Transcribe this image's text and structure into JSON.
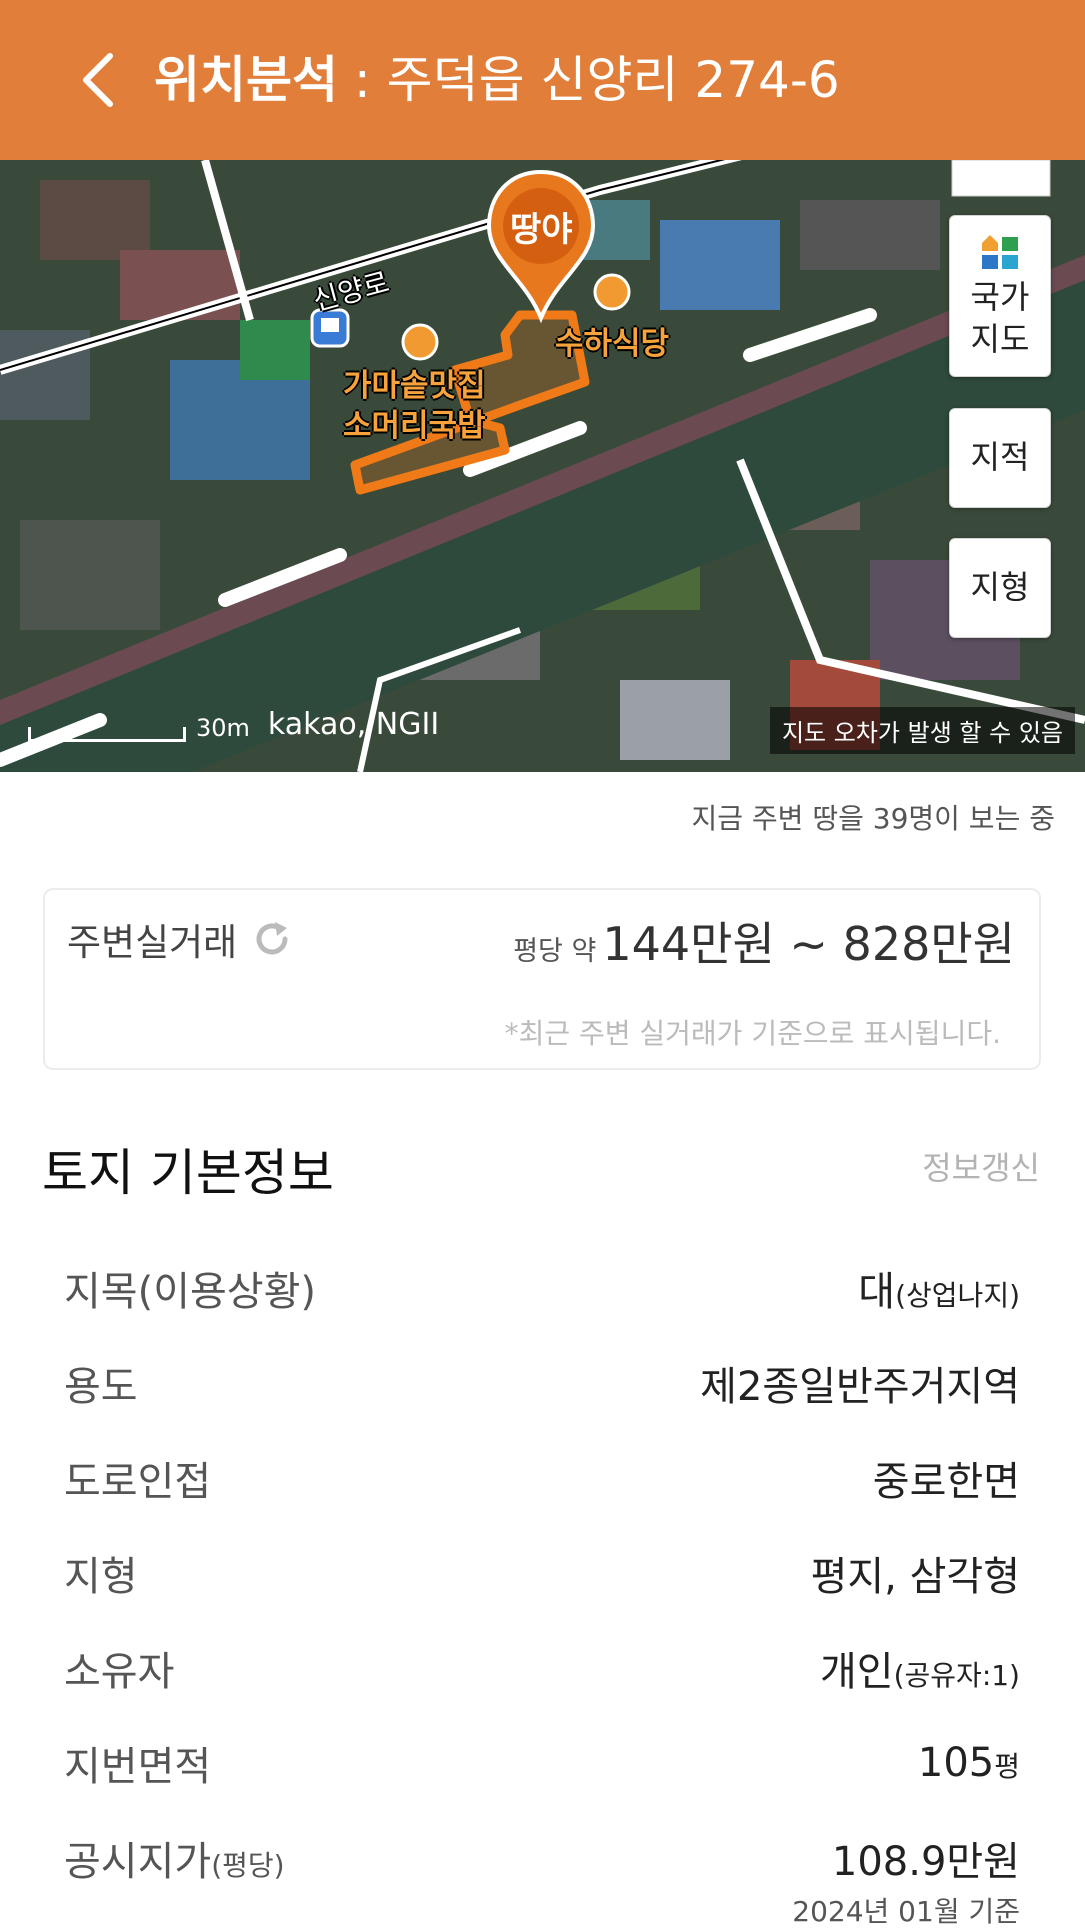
{
  "header": {
    "title_bold": "위치분석",
    "title_rest": " : 주덕읍 신양리 274-6"
  },
  "map": {
    "buttons": {
      "national_map": "국가\n지도",
      "cadastral": "지적",
      "terrain": "지형"
    },
    "pin_label": "땅야",
    "labels": {
      "road": "신양로",
      "poi_restaurant_1": "가마솥맛집",
      "poi_restaurant_1b": "소머리국밥",
      "poi_restaurant_2": "수하식당"
    },
    "scale": "30m",
    "attribution": "kakao, NGII",
    "disclaimer": "지도 오차가 발생 할 수 있음"
  },
  "viewers_text": "지금 주변 땅을 39명이 보는 중",
  "nearby_deals": {
    "label": "주변실거래",
    "price_prefix": "평당 약",
    "price_range": "144만원 ~ 828만원",
    "note": "*최근 주변 실거래가 기준으로 표시됩니다."
  },
  "land_info": {
    "title": "토지 기본정보",
    "refresh": "정보갱신",
    "rows": [
      {
        "key": "지목(이용상황)",
        "key_suffix": "",
        "value": "대",
        "value_suffix": "(상업나지)"
      },
      {
        "key": "용도",
        "key_suffix": "",
        "value": "제2종일반주거지역",
        "value_suffix": ""
      },
      {
        "key": "도로인접",
        "key_suffix": "",
        "value": "중로한면",
        "value_suffix": ""
      },
      {
        "key": "지형",
        "key_suffix": "",
        "value": "평지, 삼각형",
        "value_suffix": ""
      },
      {
        "key": "소유자",
        "key_suffix": "",
        "value": "개인",
        "value_suffix": "(공유자:1)"
      },
      {
        "key": "지번면적",
        "key_suffix": "",
        "value": "105",
        "value_suffix": "평"
      },
      {
        "key": "공시지가",
        "key_suffix": "(평당)",
        "value": "108.9만원",
        "value_suffix": ""
      }
    ],
    "date_note": "2024년 01월 기준"
  },
  "colors": {
    "header": "#e07e3a",
    "pin": "#e8781e",
    "parcel_outline": "#f07a17"
  }
}
